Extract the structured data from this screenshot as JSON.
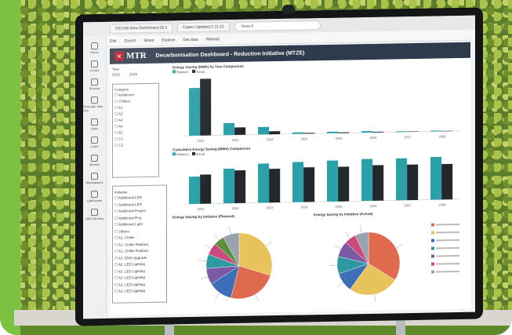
{
  "browser": {
    "tabs": [
      "DECAB-New Dashboard-26.2",
      "Capex Updated 2.11.21"
    ],
    "search_placeholder": "Search",
    "toolbar": [
      "Edit",
      "Export",
      "Share",
      "Explore",
      "Get data",
      "Refresh"
    ]
  },
  "rail": [
    "Home",
    "Create",
    "Browse",
    "OneLake data hub",
    "Apps",
    "Learn",
    "Metrics",
    "Workspaces",
    "Lakehouse",
    "DECAB-New"
  ],
  "dashboard": {
    "logo_text": "MTR",
    "title": "Decarbonisation Dashboard - Reduction Initiative (MTZE)",
    "year_label": "Year",
    "years": [
      "2023",
      "2026"
    ],
    "category_title": "Category",
    "categories": [
      "Additional",
      "Chillers",
      "A1",
      "A2",
      "A3",
      "A4",
      "B1",
      "C1",
      "C2"
    ],
    "initiative_title": "Initiative",
    "initiatives": [
      "Additional LED",
      "Additional LED",
      "Additional Project",
      "Additional Proj",
      "Additional Light",
      "Others",
      "A1. Chiller",
      "A1. Chiller Replace",
      "A1. Chiller Replace",
      "A1. EMS Upgrade",
      "A2. LED Lighting",
      "A2. LED Lighting",
      "A3. LED Lighting",
      "A3. LED Lighting",
      "A3. LED Lighting"
    ],
    "chart1_title": "Energy Saving (MWh) by Year Comparison",
    "chart2_title": "Cumulative Energy Saving (MWh) Comparison",
    "chart3_title": "Energy Saving by Initiative (Planned)",
    "chart4_title": "Energy Saving by Initiative (Actual)",
    "legend_planned": "Planned",
    "legend_actual": "Actual"
  },
  "chart_data": [
    {
      "type": "bar",
      "title": "Energy Saving (MWh) by Year Comparison",
      "categories": [
        "2021",
        "2022",
        "2023",
        "2024",
        "2025",
        "2026",
        "2027",
        "2028"
      ],
      "series": [
        {
          "name": "Planned",
          "values": [
            32,
            8,
            5,
            1,
            1,
            1,
            0.5,
            0.5
          ]
        },
        {
          "name": "Actual",
          "values": [
            38,
            5,
            2,
            0.5,
            0.5,
            0.5,
            0.3,
            0.3
          ]
        }
      ],
      "ylim": [
        0,
        40
      ]
    },
    {
      "type": "bar",
      "title": "Cumulative Energy Saving (MWh) Comparison",
      "categories": [
        "2021",
        "2022",
        "2023",
        "2024",
        "2025",
        "2026",
        "2027",
        "2028"
      ],
      "series": [
        {
          "name": "Planned",
          "values": [
            30,
            38,
            43,
            44,
            45,
            46,
            46,
            47
          ]
        },
        {
          "name": "Actual",
          "values": [
            32,
            36,
            37,
            38,
            38,
            39,
            39,
            39
          ]
        }
      ],
      "ylim": [
        0,
        50
      ]
    },
    {
      "type": "pie",
      "title": "Energy Saving by Initiative (Planned)",
      "slices": [
        {
          "value": 30,
          "color": "#e8c25a"
        },
        {
          "value": 24,
          "color": "#e06a4e"
        },
        {
          "value": 12,
          "color": "#3d6fb6"
        },
        {
          "value": 8,
          "color": "#7a5aa6"
        },
        {
          "value": 7,
          "color": "#2e9aa0"
        },
        {
          "value": 6,
          "color": "#c94a7b"
        },
        {
          "value": 5,
          "color": "#5a8f3e"
        },
        {
          "value": 8,
          "color": "#9aa3ad"
        }
      ]
    },
    {
      "type": "pie",
      "title": "Energy Saving by Initiative (Actual)",
      "slices": [
        {
          "value": 34,
          "color": "#e06a4e"
        },
        {
          "value": 26,
          "color": "#e8c25a"
        },
        {
          "value": 10,
          "color": "#3d6fb6"
        },
        {
          "value": 9,
          "color": "#2e9aa0"
        },
        {
          "value": 8,
          "color": "#7a5aa6"
        },
        {
          "value": 6,
          "color": "#c94a7b"
        },
        {
          "value": 7,
          "color": "#9aa3ad"
        }
      ]
    }
  ],
  "colors": {
    "planned": "#2aa1a9",
    "actual": "#23282d",
    "brand": "#b3192e"
  }
}
